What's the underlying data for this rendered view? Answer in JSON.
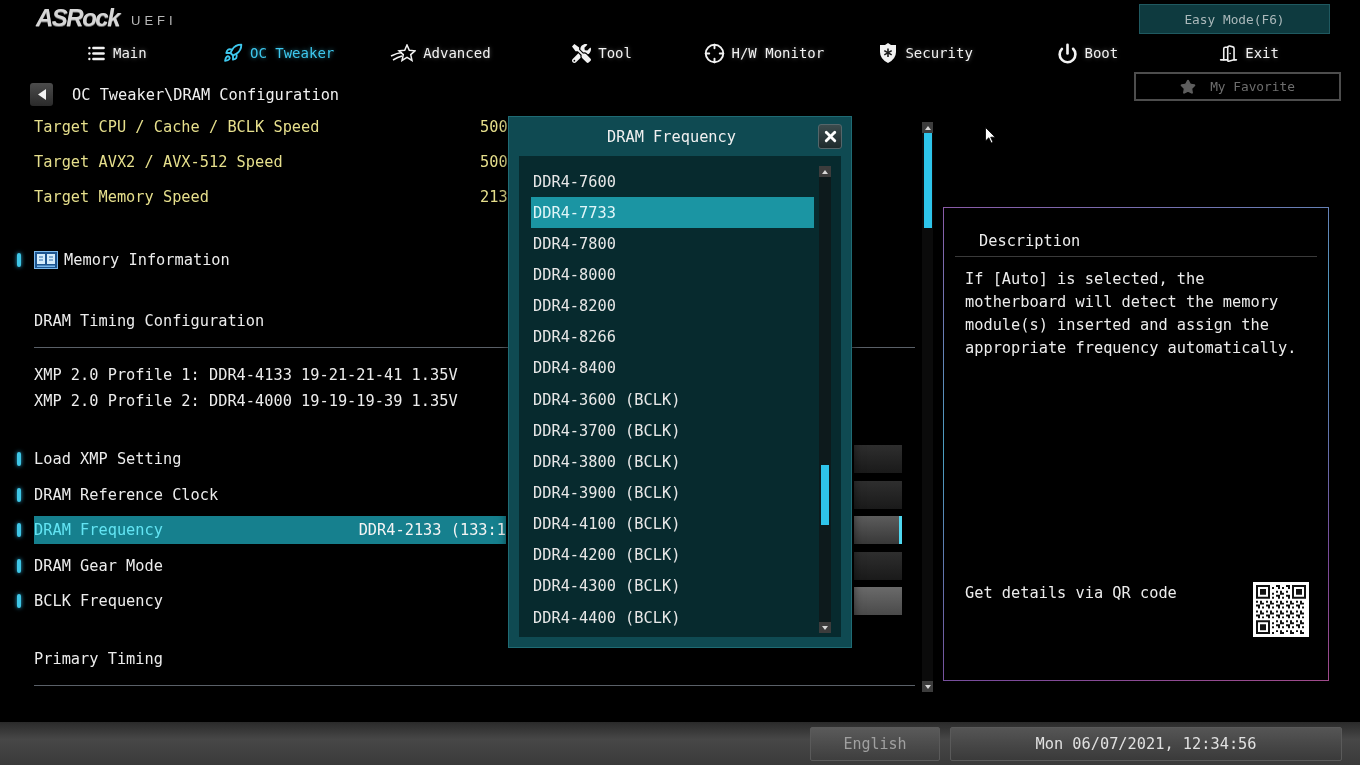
{
  "header": {
    "logo": "ASRock",
    "logo_suffix": "UEFI",
    "easy_mode_button": "Easy Mode(F6)",
    "favorite_button": "My Favorite"
  },
  "tabs": [
    {
      "label": "Main",
      "selected": false
    },
    {
      "label": "OC Tweaker",
      "selected": true
    },
    {
      "label": "Advanced",
      "selected": false
    },
    {
      "label": "Tool",
      "selected": false
    },
    {
      "label": "H/W Monitor",
      "selected": false
    },
    {
      "label": "Security",
      "selected": false
    },
    {
      "label": "Boot",
      "selected": false
    },
    {
      "label": "Exit",
      "selected": false
    }
  ],
  "breadcrumb": {
    "path": "OC Tweaker\\DRAM Configuration"
  },
  "settings": [
    {
      "kind": "info",
      "label": "Target CPU / Cache / BCLK Speed",
      "value": "500"
    },
    {
      "kind": "info",
      "label": "Target AVX2 / AVX-512 Speed",
      "value": "500"
    },
    {
      "kind": "info",
      "label": "Target Memory Speed",
      "value": "213"
    },
    {
      "kind": "submenu",
      "label": "Memory Information",
      "selected": false
    },
    {
      "kind": "heading",
      "label": "DRAM Timing Configuration"
    },
    {
      "kind": "note",
      "label": "XMP 2.0 Profile 1: DDR4-4133 19-21-21-41 1.35V"
    },
    {
      "kind": "note",
      "label": "XMP 2.0 Profile 2: DDR4-4000 19-19-19-39 1.35V"
    },
    {
      "kind": "option",
      "label": "Load XMP Setting",
      "selected": false
    },
    {
      "kind": "option",
      "label": "DRAM Reference Clock",
      "selected": false
    },
    {
      "kind": "option",
      "label": "DRAM Frequency",
      "value": "DDR4-2133 (133:1",
      "selected": true
    },
    {
      "kind": "option",
      "label": "DRAM Gear Mode",
      "selected": false
    },
    {
      "kind": "input",
      "label": "BCLK Frequency",
      "selected": false
    },
    {
      "kind": "heading",
      "label": "Primary Timing"
    }
  ],
  "dialog": {
    "title": "DRAM Frequency",
    "options": [
      {
        "label": "DDR4-7600",
        "selected": false
      },
      {
        "label": "DDR4-7733",
        "selected": true
      },
      {
        "label": "DDR4-7800",
        "selected": false
      },
      {
        "label": "DDR4-8000",
        "selected": false
      },
      {
        "label": "DDR4-8200",
        "selected": false
      },
      {
        "label": "DDR4-8266",
        "selected": false
      },
      {
        "label": "DDR4-8400",
        "selected": false
      },
      {
        "label": "DDR4-3600 (BCLK)",
        "selected": false
      },
      {
        "label": "DDR4-3700 (BCLK)",
        "selected": false
      },
      {
        "label": "DDR4-3800 (BCLK)",
        "selected": false
      },
      {
        "label": "DDR4-3900 (BCLK)",
        "selected": false
      },
      {
        "label": "DDR4-4100 (BCLK)",
        "selected": false
      },
      {
        "label": "DDR4-4200 (BCLK)",
        "selected": false
      },
      {
        "label": "DDR4-4300 (BCLK)",
        "selected": false
      },
      {
        "label": "DDR4-4400 (BCLK)",
        "selected": false
      }
    ]
  },
  "description": {
    "title": "Description",
    "text": "If [Auto] is selected, the motherboard will detect the memory module(s) inserted and assign the appropriate frequency automatically.",
    "qr_caption": "Get details via QR code"
  },
  "status_bar": {
    "language_button": "English",
    "datetime": "Mon 06/07/2021, 12:34:56"
  }
}
